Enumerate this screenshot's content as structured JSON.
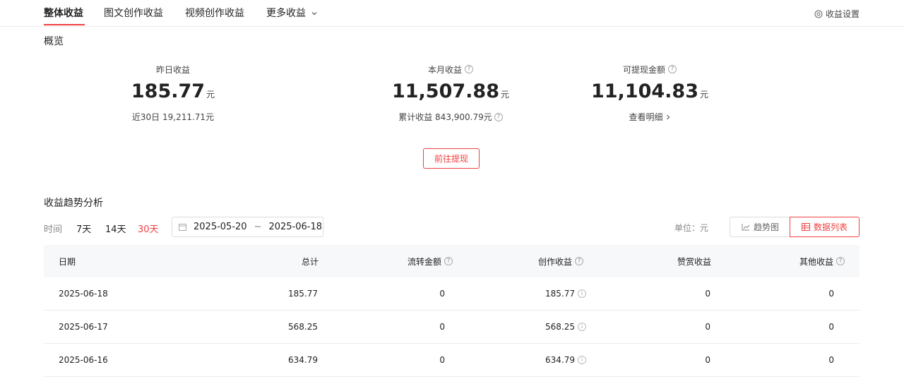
{
  "tabs": [
    {
      "label": "整体收益",
      "active": true
    },
    {
      "label": "图文创作收益",
      "active": false
    },
    {
      "label": "视频创作收益",
      "active": false
    },
    {
      "label": "更多收益",
      "active": false
    }
  ],
  "settings_label": "收益设置",
  "overview": {
    "title": "概览",
    "yesterday": {
      "label": "昨日收益",
      "value": "185.77",
      "unit": "元",
      "sub": "近30日 19,211.71元"
    },
    "month": {
      "label": "本月收益",
      "value": "11,507.88",
      "unit": "元",
      "sub": "累计收益 843,900.79元"
    },
    "withdrawable": {
      "label": "可提现金额",
      "value": "11,104.83",
      "unit": "元",
      "sub": "查看明细"
    },
    "withdraw_button": "前往提现"
  },
  "trend": {
    "title": "收益趋势分析",
    "time_label": "时间",
    "ranges": [
      "7天",
      "14天",
      "30天"
    ],
    "active_range": "30天",
    "date_start": "2025-05-20",
    "date_sep": "~",
    "date_end": "2025-06-18",
    "unit_label": "单位：元",
    "view_chart": "趋势图",
    "view_table": "数据列表"
  },
  "table": {
    "headers": [
      "日期",
      "总计",
      "流转金额",
      "创作收益",
      "赞赏收益",
      "其他收益"
    ],
    "rows": [
      {
        "date": "2025-06-18",
        "total": "185.77",
        "transfer": "0",
        "creation": "185.77",
        "reward": "0",
        "other": "0"
      },
      {
        "date": "2025-06-17",
        "total": "568.25",
        "transfer": "0",
        "creation": "568.25",
        "reward": "0",
        "other": "0"
      },
      {
        "date": "2025-06-16",
        "total": "634.79",
        "transfer": "0",
        "creation": "634.79",
        "reward": "0",
        "other": "0"
      }
    ]
  },
  "colors": {
    "accent": "#f04142",
    "header_bg": "#f7f8fa",
    "border": "#ececec"
  },
  "icons": [
    "chevron-down-icon",
    "settings-icon",
    "help-icon",
    "chevron-right-icon",
    "calendar-icon",
    "trend-chart-icon",
    "table-icon",
    "info-icon"
  ]
}
